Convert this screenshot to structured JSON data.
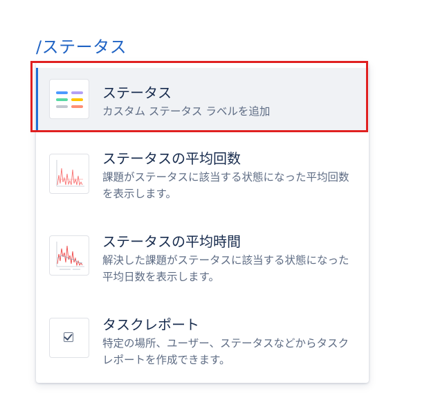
{
  "slash_command": "/ステータス",
  "items": [
    {
      "title": "ステータス",
      "description": "カスタム ステータス ラベルを追加",
      "icon": "status-labels-icon",
      "selected": true
    },
    {
      "title": "ステータスの平均回数",
      "description": "課題がステータスに該当する状態になった平均回数を表示します。",
      "icon": "average-count-chart-icon",
      "selected": false
    },
    {
      "title": "ステータスの平均時間",
      "description": "解決した課題がステータスに該当する状態になった平均日数を表示します。",
      "icon": "average-time-chart-icon",
      "selected": false
    },
    {
      "title": "タスクレポート",
      "description": "特定の場所、ユーザー、ステータスなどからタスクレポートを作成できます。",
      "icon": "checkbox-icon",
      "selected": false
    }
  ],
  "colors": {
    "accent": "#1f6fd6",
    "highlight_ring": "#e02020",
    "command_text": "#1f63c4",
    "status_labels": [
      "#4c9aff",
      "#b3a0f5",
      "#57d9a3",
      "#ffc400",
      "#c1c7d0",
      "#ff8f73"
    ]
  }
}
